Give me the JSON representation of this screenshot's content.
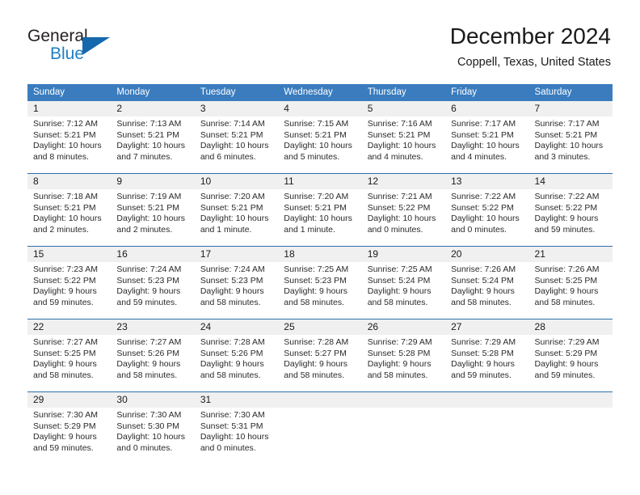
{
  "brand": {
    "name_top": "General",
    "name_bottom": "Blue",
    "accent_color": "#1668ad",
    "text_color": "#231f20"
  },
  "header": {
    "title": "December 2024",
    "subtitle": "Coppell, Texas, United States"
  },
  "calendar": {
    "header_bg": "#3a7cbe",
    "header_text_color": "#ffffff",
    "row_divider_color": "#2f6fae",
    "day_band_bg": "#f0f0f0",
    "weekdays": [
      "Sunday",
      "Monday",
      "Tuesday",
      "Wednesday",
      "Thursday",
      "Friday",
      "Saturday"
    ],
    "weeks": [
      [
        {
          "day": "1",
          "sunrise": "Sunrise: 7:12 AM",
          "sunset": "Sunset: 5:21 PM",
          "daylight_1": "Daylight: 10 hours",
          "daylight_2": "and 8 minutes."
        },
        {
          "day": "2",
          "sunrise": "Sunrise: 7:13 AM",
          "sunset": "Sunset: 5:21 PM",
          "daylight_1": "Daylight: 10 hours",
          "daylight_2": "and 7 minutes."
        },
        {
          "day": "3",
          "sunrise": "Sunrise: 7:14 AM",
          "sunset": "Sunset: 5:21 PM",
          "daylight_1": "Daylight: 10 hours",
          "daylight_2": "and 6 minutes."
        },
        {
          "day": "4",
          "sunrise": "Sunrise: 7:15 AM",
          "sunset": "Sunset: 5:21 PM",
          "daylight_1": "Daylight: 10 hours",
          "daylight_2": "and 5 minutes."
        },
        {
          "day": "5",
          "sunrise": "Sunrise: 7:16 AM",
          "sunset": "Sunset: 5:21 PM",
          "daylight_1": "Daylight: 10 hours",
          "daylight_2": "and 4 minutes."
        },
        {
          "day": "6",
          "sunrise": "Sunrise: 7:17 AM",
          "sunset": "Sunset: 5:21 PM",
          "daylight_1": "Daylight: 10 hours",
          "daylight_2": "and 4 minutes."
        },
        {
          "day": "7",
          "sunrise": "Sunrise: 7:17 AM",
          "sunset": "Sunset: 5:21 PM",
          "daylight_1": "Daylight: 10 hours",
          "daylight_2": "and 3 minutes."
        }
      ],
      [
        {
          "day": "8",
          "sunrise": "Sunrise: 7:18 AM",
          "sunset": "Sunset: 5:21 PM",
          "daylight_1": "Daylight: 10 hours",
          "daylight_2": "and 2 minutes."
        },
        {
          "day": "9",
          "sunrise": "Sunrise: 7:19 AM",
          "sunset": "Sunset: 5:21 PM",
          "daylight_1": "Daylight: 10 hours",
          "daylight_2": "and 2 minutes."
        },
        {
          "day": "10",
          "sunrise": "Sunrise: 7:20 AM",
          "sunset": "Sunset: 5:21 PM",
          "daylight_1": "Daylight: 10 hours",
          "daylight_2": "and 1 minute."
        },
        {
          "day": "11",
          "sunrise": "Sunrise: 7:20 AM",
          "sunset": "Sunset: 5:21 PM",
          "daylight_1": "Daylight: 10 hours",
          "daylight_2": "and 1 minute."
        },
        {
          "day": "12",
          "sunrise": "Sunrise: 7:21 AM",
          "sunset": "Sunset: 5:22 PM",
          "daylight_1": "Daylight: 10 hours",
          "daylight_2": "and 0 minutes."
        },
        {
          "day": "13",
          "sunrise": "Sunrise: 7:22 AM",
          "sunset": "Sunset: 5:22 PM",
          "daylight_1": "Daylight: 10 hours",
          "daylight_2": "and 0 minutes."
        },
        {
          "day": "14",
          "sunrise": "Sunrise: 7:22 AM",
          "sunset": "Sunset: 5:22 PM",
          "daylight_1": "Daylight: 9 hours",
          "daylight_2": "and 59 minutes."
        }
      ],
      [
        {
          "day": "15",
          "sunrise": "Sunrise: 7:23 AM",
          "sunset": "Sunset: 5:22 PM",
          "daylight_1": "Daylight: 9 hours",
          "daylight_2": "and 59 minutes."
        },
        {
          "day": "16",
          "sunrise": "Sunrise: 7:24 AM",
          "sunset": "Sunset: 5:23 PM",
          "daylight_1": "Daylight: 9 hours",
          "daylight_2": "and 59 minutes."
        },
        {
          "day": "17",
          "sunrise": "Sunrise: 7:24 AM",
          "sunset": "Sunset: 5:23 PM",
          "daylight_1": "Daylight: 9 hours",
          "daylight_2": "and 58 minutes."
        },
        {
          "day": "18",
          "sunrise": "Sunrise: 7:25 AM",
          "sunset": "Sunset: 5:23 PM",
          "daylight_1": "Daylight: 9 hours",
          "daylight_2": "and 58 minutes."
        },
        {
          "day": "19",
          "sunrise": "Sunrise: 7:25 AM",
          "sunset": "Sunset: 5:24 PM",
          "daylight_1": "Daylight: 9 hours",
          "daylight_2": "and 58 minutes."
        },
        {
          "day": "20",
          "sunrise": "Sunrise: 7:26 AM",
          "sunset": "Sunset: 5:24 PM",
          "daylight_1": "Daylight: 9 hours",
          "daylight_2": "and 58 minutes."
        },
        {
          "day": "21",
          "sunrise": "Sunrise: 7:26 AM",
          "sunset": "Sunset: 5:25 PM",
          "daylight_1": "Daylight: 9 hours",
          "daylight_2": "and 58 minutes."
        }
      ],
      [
        {
          "day": "22",
          "sunrise": "Sunrise: 7:27 AM",
          "sunset": "Sunset: 5:25 PM",
          "daylight_1": "Daylight: 9 hours",
          "daylight_2": "and 58 minutes."
        },
        {
          "day": "23",
          "sunrise": "Sunrise: 7:27 AM",
          "sunset": "Sunset: 5:26 PM",
          "daylight_1": "Daylight: 9 hours",
          "daylight_2": "and 58 minutes."
        },
        {
          "day": "24",
          "sunrise": "Sunrise: 7:28 AM",
          "sunset": "Sunset: 5:26 PM",
          "daylight_1": "Daylight: 9 hours",
          "daylight_2": "and 58 minutes."
        },
        {
          "day": "25",
          "sunrise": "Sunrise: 7:28 AM",
          "sunset": "Sunset: 5:27 PM",
          "daylight_1": "Daylight: 9 hours",
          "daylight_2": "and 58 minutes."
        },
        {
          "day": "26",
          "sunrise": "Sunrise: 7:29 AM",
          "sunset": "Sunset: 5:28 PM",
          "daylight_1": "Daylight: 9 hours",
          "daylight_2": "and 58 minutes."
        },
        {
          "day": "27",
          "sunrise": "Sunrise: 7:29 AM",
          "sunset": "Sunset: 5:28 PM",
          "daylight_1": "Daylight: 9 hours",
          "daylight_2": "and 59 minutes."
        },
        {
          "day": "28",
          "sunrise": "Sunrise: 7:29 AM",
          "sunset": "Sunset: 5:29 PM",
          "daylight_1": "Daylight: 9 hours",
          "daylight_2": "and 59 minutes."
        }
      ],
      [
        {
          "day": "29",
          "sunrise": "Sunrise: 7:30 AM",
          "sunset": "Sunset: 5:29 PM",
          "daylight_1": "Daylight: 9 hours",
          "daylight_2": "and 59 minutes."
        },
        {
          "day": "30",
          "sunrise": "Sunrise: 7:30 AM",
          "sunset": "Sunset: 5:30 PM",
          "daylight_1": "Daylight: 10 hours",
          "daylight_2": "and 0 minutes."
        },
        {
          "day": "31",
          "sunrise": "Sunrise: 7:30 AM",
          "sunset": "Sunset: 5:31 PM",
          "daylight_1": "Daylight: 10 hours",
          "daylight_2": "and 0 minutes."
        },
        {
          "day": "",
          "sunrise": "",
          "sunset": "",
          "daylight_1": "",
          "daylight_2": ""
        },
        {
          "day": "",
          "sunrise": "",
          "sunset": "",
          "daylight_1": "",
          "daylight_2": ""
        },
        {
          "day": "",
          "sunrise": "",
          "sunset": "",
          "daylight_1": "",
          "daylight_2": ""
        },
        {
          "day": "",
          "sunrise": "",
          "sunset": "",
          "daylight_1": "",
          "daylight_2": ""
        }
      ]
    ]
  }
}
